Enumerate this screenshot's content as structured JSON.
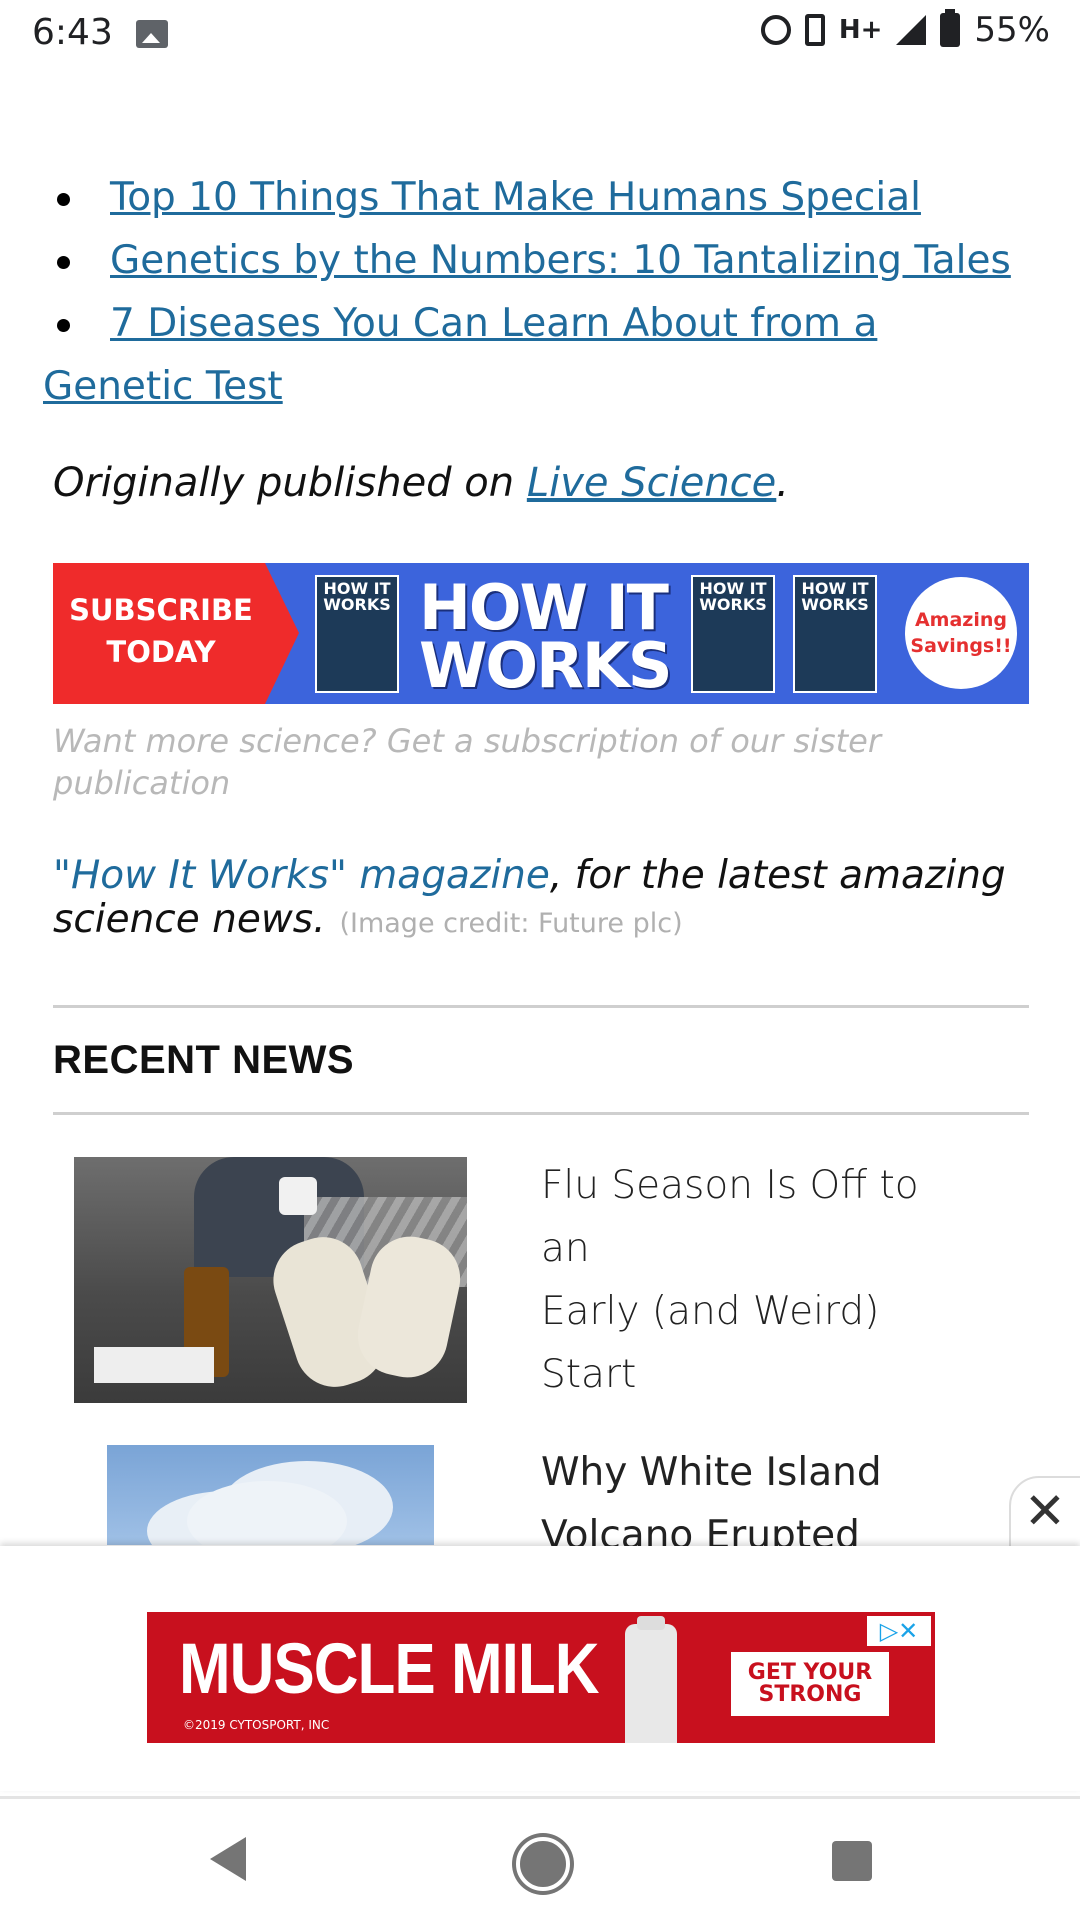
{
  "status_bar": {
    "time": "6:43",
    "network": "H+",
    "battery": "55%"
  },
  "related_links": [
    "Top 10 Things That Make Humans Special",
    "Genetics by the Numbers: 10 Tantalizing Tales",
    "7 Diseases You Can Learn About from a",
    "Genetic Test"
  ],
  "origin": {
    "prefix": "Originally published on ",
    "link": "Live Science",
    "suffix": "."
  },
  "banner": {
    "subscribe_line1": "SUBSCRIBE",
    "subscribe_line2": "TODAY",
    "logo_line1": "HOW IT",
    "logo_line2": "WORKS",
    "badge_line1": "Amazing",
    "badge_line2": "Savings!!",
    "cover_labels": [
      "HOW IT WORKS",
      "HOW IT WORKS",
      "HOW IT WORKS"
    ]
  },
  "caption": {
    "gray_line1": "Want more science? Get a subscription of our sister",
    "gray_line2": "publication",
    "link": "\"How It Works\" magazine",
    "rest_line1": ", for the latest amazing",
    "rest_line2": "science news.",
    "credit": "(Image credit: Future plc)"
  },
  "recent_news": {
    "heading": "RECENT NEWS",
    "items": [
      {
        "line1": "Flu Season Is Off to an",
        "line2": "Early (and Weird) Start"
      },
      {
        "line1": "Why White Island",
        "line2": "Volcano Erupted"
      }
    ]
  },
  "close_symbol": "✕",
  "ad": {
    "brand": "MUSCLE MILK",
    "small_print": "©2019 CYTOSPORT, INC",
    "cta_line1": "GET YOUR",
    "cta_line2": "STRONG",
    "adchoice": "▷✕"
  },
  "nav": {
    "back": "back",
    "home": "home",
    "recents": "recents"
  }
}
